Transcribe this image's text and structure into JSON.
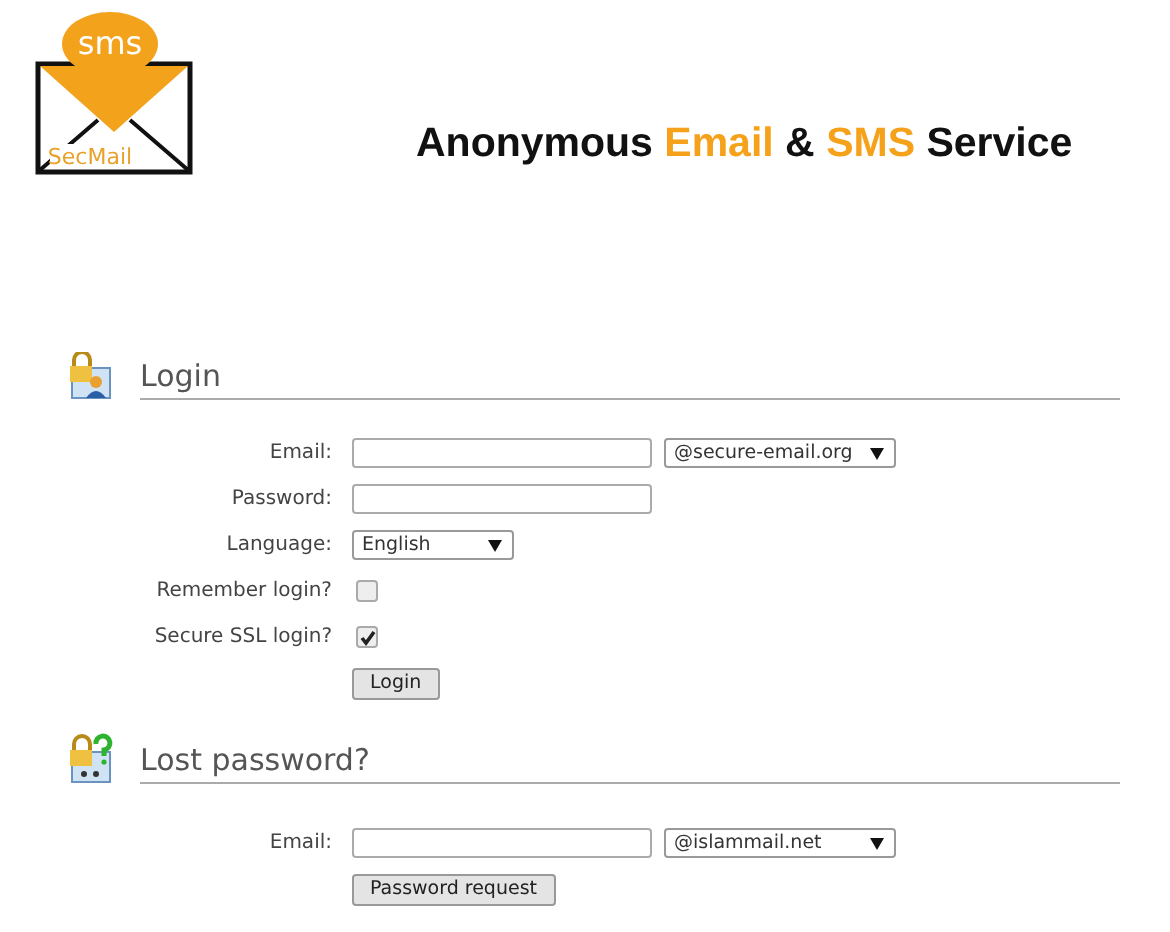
{
  "logo": {
    "badge": "sms",
    "name": "SecMail"
  },
  "title_parts": [
    {
      "text": "Anonymous ",
      "highlight": false
    },
    {
      "text": "Email",
      "highlight": true
    },
    {
      "text": " & ",
      "highlight": false
    },
    {
      "text": "SMS",
      "highlight": true
    },
    {
      "text": " Service",
      "highlight": false
    }
  ],
  "sections": [
    {
      "kind": "login",
      "heading": "Login",
      "fields": [
        {
          "kind": "email",
          "label": "Email:",
          "domain": "@secure-email.org"
        },
        {
          "kind": "password",
          "label": "Password:"
        },
        {
          "kind": "select",
          "label": "Language:",
          "value": "English"
        },
        {
          "kind": "checkbox",
          "label": "Remember login?",
          "checked": false
        },
        {
          "kind": "checkbox",
          "label": "Secure SSL login?",
          "checked": true
        },
        {
          "kind": "button",
          "label": "Login"
        }
      ]
    },
    {
      "kind": "recovery",
      "heading": "Lost password?",
      "fields": [
        {
          "kind": "email",
          "label": "Email:",
          "domain": "@islammail.net"
        },
        {
          "kind": "button",
          "label": "Password request"
        }
      ]
    }
  ]
}
